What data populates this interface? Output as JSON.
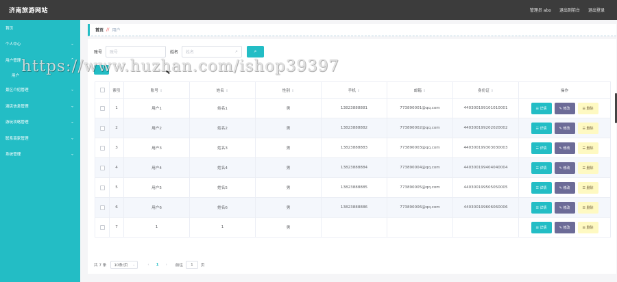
{
  "app": {
    "title": "济南旅游网站"
  },
  "header": {
    "admin_label": "管理员 abo",
    "back_label": "退出到前台",
    "logout_label": "退出登录"
  },
  "sidebar": {
    "items": [
      {
        "label": "首页",
        "has_arrow": false
      },
      {
        "label": "个人中心",
        "has_arrow": true
      },
      {
        "label": "用户管理",
        "has_arrow": true,
        "sub": "用户"
      },
      {
        "label": "景区介绍管理",
        "has_arrow": true
      },
      {
        "label": "酒店信息管理",
        "has_arrow": true
      },
      {
        "label": "游玩攻略管理",
        "has_arrow": true
      },
      {
        "label": "联系商家管理",
        "has_arrow": true
      },
      {
        "label": "系统管理",
        "has_arrow": true
      }
    ]
  },
  "breadcrumb": {
    "home": "首页",
    "separator": "//",
    "current": "用户"
  },
  "search": {
    "account_label": "账号",
    "account_placeholder": "账号",
    "name_label": "姓名",
    "name_placeholder": "姓名",
    "button_icon": "search-icon"
  },
  "table": {
    "headers": [
      "",
      "索引",
      "账号",
      "姓名",
      "性别",
      "手机",
      "邮箱",
      "身份证",
      "操作"
    ],
    "rows": [
      {
        "index": "1",
        "account": "用户1",
        "name": "姓名1",
        "gender": "男",
        "phone": "13823888881",
        "email": "773890001@qq.com",
        "idcard": "440300199101010001"
      },
      {
        "index": "2",
        "account": "用户2",
        "name": "姓名2",
        "gender": "男",
        "phone": "13823888882",
        "email": "773890002@qq.com",
        "idcard": "440300199202020002"
      },
      {
        "index": "3",
        "account": "用户3",
        "name": "姓名3",
        "gender": "男",
        "phone": "13823888883",
        "email": "773890003@qq.com",
        "idcard": "440300199303030003"
      },
      {
        "index": "4",
        "account": "用户4",
        "name": "姓名4",
        "gender": "男",
        "phone": "13823888884",
        "email": "773890004@qq.com",
        "idcard": "440300199404040004"
      },
      {
        "index": "5",
        "account": "用户5",
        "name": "姓名5",
        "gender": "男",
        "phone": "13823888885",
        "email": "773890005@qq.com",
        "idcard": "440300199505050005"
      },
      {
        "index": "6",
        "account": "用户6",
        "name": "姓名6",
        "gender": "男",
        "phone": "13823888886",
        "email": "773890006@qq.com",
        "idcard": "440300199606060006"
      },
      {
        "index": "7",
        "account": "1",
        "name": "1",
        "gender": "男",
        "phone": "",
        "email": "",
        "idcard": ""
      }
    ],
    "actions": {
      "detail": "☰ 详情",
      "edit": "✎ 修改",
      "delete": "☰ 删除"
    }
  },
  "pagination": {
    "total": "共 7 条",
    "page_size": "10条/页",
    "prev": "‹",
    "current_page": "1",
    "next": "›",
    "goto_label": "前往",
    "goto_value": "1",
    "page_suffix": "页"
  },
  "watermark": {
    "text": "https://www.huzhan.com/ishop39397"
  }
}
